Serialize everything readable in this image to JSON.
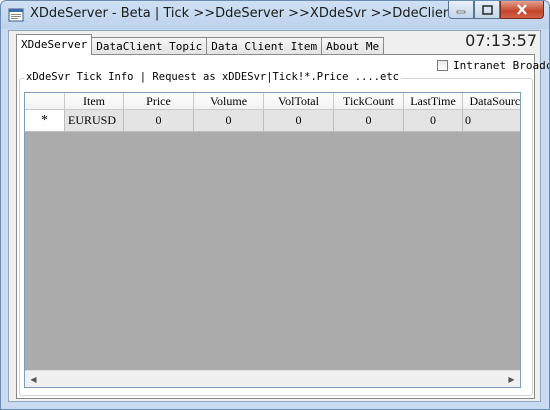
{
  "window": {
    "title": "XDdeServer - Beta | Tick >>DdeServer >>XDdeSvr >>DdeClient",
    "app_icon": "app-window-icon",
    "controls": {
      "minimize": "minimize-icon",
      "maximize": "maximize-icon",
      "close": "close-icon"
    }
  },
  "tabs": [
    {
      "label": "XDdeServer",
      "active": true
    },
    {
      "label": "DataClient Topic",
      "active": false
    },
    {
      "label": "Data Client Item",
      "active": false
    },
    {
      "label": "About Me",
      "active": false
    }
  ],
  "clock": "07:13:57",
  "intranet": {
    "label": "Intranet Broadcast",
    "checked": false
  },
  "group": {
    "legend": "xDdeSvr Tick Info |  Request as xDDESvr|Tick!*.Price ....etc"
  },
  "grid": {
    "columns": [
      "Item",
      "Price",
      "Volume",
      "VolTotal",
      "TickCount",
      "LastTime",
      "DataSource"
    ],
    "rows": [
      {
        "marker": "*",
        "cells": [
          "EURUSD",
          "0",
          "0",
          "0",
          "0",
          "0",
          "0"
        ]
      }
    ]
  },
  "colors": {
    "grid_background": "#ababab",
    "row_background": "#e4e4e4",
    "title_bar": "#bcd3ec",
    "close_button": "#c4452b"
  }
}
